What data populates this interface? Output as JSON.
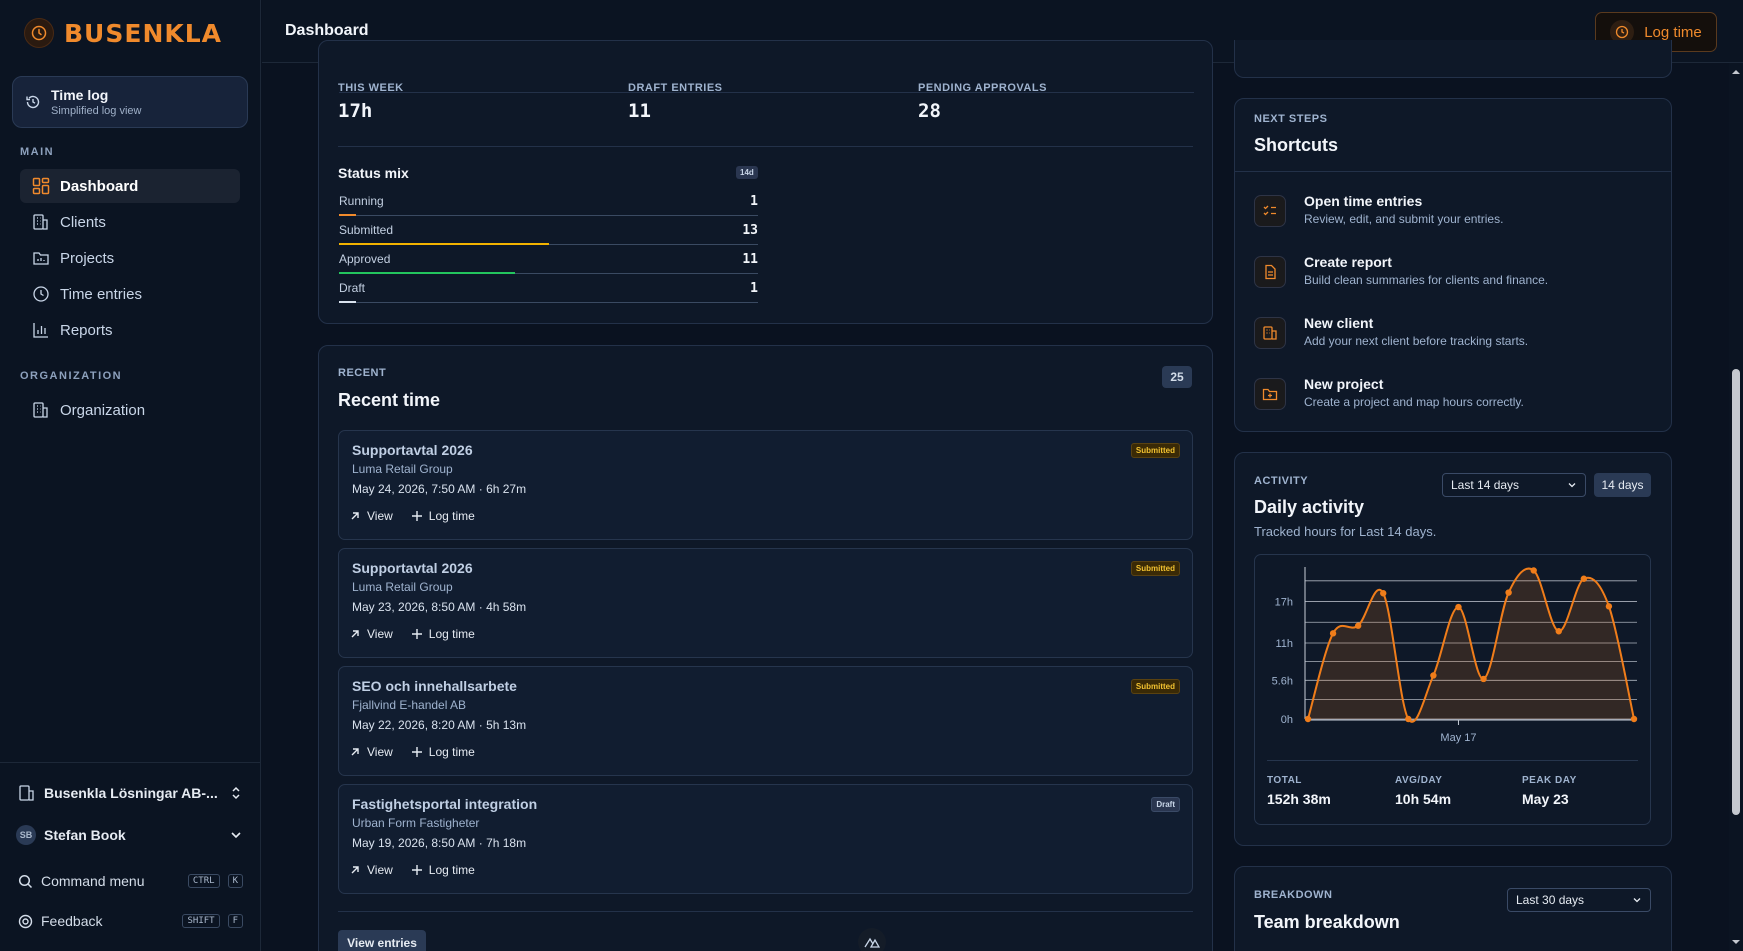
{
  "app": {
    "logo_text": "BUSENKLA"
  },
  "header": {
    "title": "Dashboard",
    "log_time_label": "Log time"
  },
  "sidebar": {
    "time_log": {
      "title": "Time log",
      "subtitle": "Simplified log view"
    },
    "main_label": "MAIN",
    "items": [
      {
        "label": "Dashboard",
        "icon": "dashboard-icon",
        "active": true
      },
      {
        "label": "Clients",
        "icon": "building-icon",
        "active": false
      },
      {
        "label": "Projects",
        "icon": "folder-chart-icon",
        "active": false
      },
      {
        "label": "Time entries",
        "icon": "clock-icon",
        "active": false
      },
      {
        "label": "Reports",
        "icon": "bar-chart-icon",
        "active": false
      }
    ],
    "organization_label": "ORGANIZATION",
    "organization_item": "Organization",
    "org_switcher": "Busenkla Lösningar AB-...",
    "user": {
      "initials": "SB",
      "name": "Stefan Book"
    },
    "command_menu": {
      "label": "Command menu",
      "keys": [
        "CTRL",
        "K"
      ]
    },
    "feedback": {
      "label": "Feedback",
      "keys": [
        "SHIFT",
        "F"
      ]
    }
  },
  "summary": {
    "stats": [
      {
        "label": "THIS WEEK",
        "value": "17h"
      },
      {
        "label": "DRAFT ENTRIES",
        "value": "11"
      },
      {
        "label": "PENDING APPROVALS",
        "value": "28"
      }
    ],
    "status_mix": {
      "title": "Status mix",
      "badge": "14d",
      "rows": [
        {
          "label": "Running",
          "count": "1",
          "fraction": 0.04,
          "color": "#f08a2c"
        },
        {
          "label": "Submitted",
          "count": "13",
          "fraction": 0.5,
          "color": "#f2b200"
        },
        {
          "label": "Approved",
          "count": "11",
          "fraction": 0.42,
          "color": "#23c55e"
        },
        {
          "label": "Draft",
          "count": "1",
          "fraction": 0.04,
          "color": "#d9e2ee"
        }
      ]
    }
  },
  "recent": {
    "eyebrow": "RECENT",
    "title": "Recent time",
    "count": "25",
    "view_label": "View",
    "log_label": "Log time",
    "entries": [
      {
        "title": "Supportavtal 2026",
        "client": "Luma Retail Group",
        "when": "May 24, 2026, 7:50 AM · 6h 27m",
        "status": "Submitted"
      },
      {
        "title": "Supportavtal 2026",
        "client": "Luma Retail Group",
        "when": "May 23, 2026, 8:50 AM · 4h 58m",
        "status": "Submitted"
      },
      {
        "title": "SEO och innehallsarbete",
        "client": "Fjallvind E-handel AB",
        "when": "May 22, 2026, 8:20 AM · 5h 13m",
        "status": "Submitted"
      },
      {
        "title": "Fastighetsportal integration",
        "client": "Urban Form Fastigheter",
        "when": "May 19, 2026, 8:50 AM · 7h 18m",
        "status": "Draft"
      }
    ],
    "view_entries_label": "View entries"
  },
  "shortcuts": {
    "eyebrow": "NEXT STEPS",
    "title": "Shortcuts",
    "items": [
      {
        "title": "Open time entries",
        "desc": "Review, edit, and submit your entries.",
        "icon": "checklist-icon"
      },
      {
        "title": "Create report",
        "desc": "Build clean summaries for clients and finance.",
        "icon": "document-icon"
      },
      {
        "title": "New client",
        "desc": "Add your next client before tracking starts.",
        "icon": "building-icon"
      },
      {
        "title": "New project",
        "desc": "Create a project and map hours correctly.",
        "icon": "folder-plus-icon"
      }
    ]
  },
  "activity": {
    "eyebrow": "ACTIVITY",
    "title": "Daily activity",
    "subtitle": "Tracked hours for Last 14 days.",
    "range_select": "Last 14 days",
    "range_badge": "14 days",
    "totals": [
      {
        "label": "TOTAL",
        "value": "152h 38m"
      },
      {
        "label": "AVG/DAY",
        "value": "10h 54m"
      },
      {
        "label": "PEAK DAY",
        "value": "May 23"
      }
    ]
  },
  "chart_data": {
    "type": "area",
    "x_tick_labels": [
      "May 17"
    ],
    "y_tick_labels": [
      "0h",
      "5.6h",
      "11h",
      "17h"
    ],
    "ylim": [
      0,
      22
    ],
    "x": [
      "May 11",
      "May 12",
      "May 13",
      "May 14",
      "May 15",
      "May 16",
      "May 17",
      "May 18",
      "May 19",
      "May 20",
      "May 21",
      "May 22",
      "May 23",
      "May 24"
    ],
    "values": [
      0,
      12.4,
      13.5,
      18.2,
      0,
      6.3,
      16.2,
      5.8,
      18.3,
      21.5,
      12.7,
      20.3,
      16.3,
      0
    ],
    "color": "#f07d1a",
    "grid": true
  },
  "breakdown": {
    "eyebrow": "BREAKDOWN",
    "title": "Team breakdown",
    "range_select": "Last 30 days"
  }
}
